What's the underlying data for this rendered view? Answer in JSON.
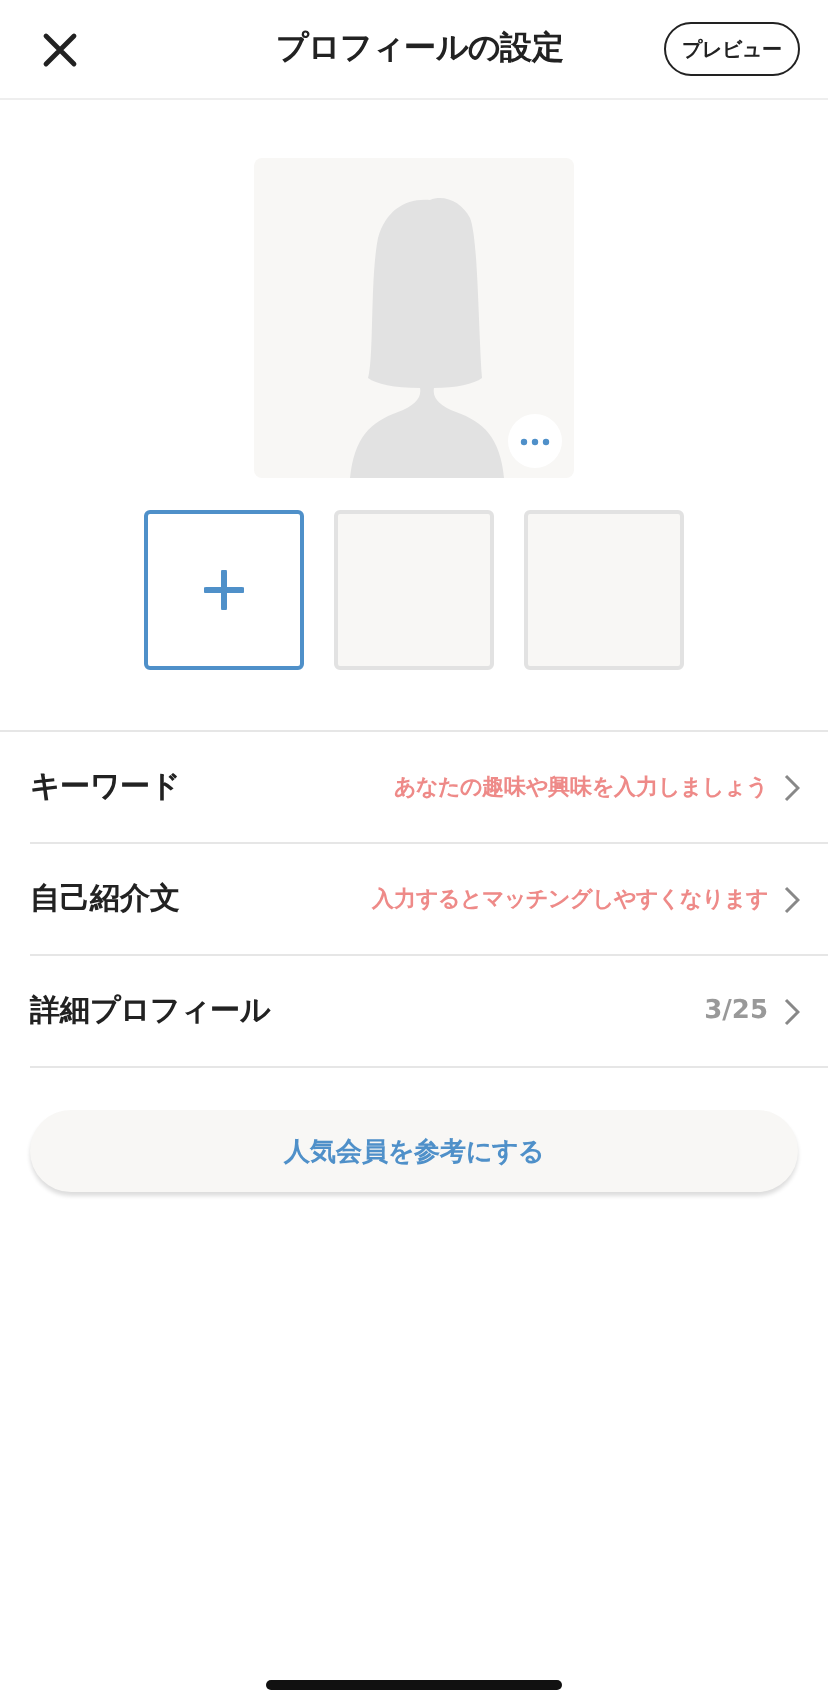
{
  "header": {
    "title": "プロフィールの設定",
    "preview_button": "プレビュー"
  },
  "photos": {
    "slots": [
      {
        "kind": "add"
      },
      {
        "kind": "empty"
      },
      {
        "kind": "empty"
      }
    ]
  },
  "rows": [
    {
      "label": "キーワード",
      "value": "あなたの趣味や興味を入力しましょう",
      "kind": "hint"
    },
    {
      "label": "自己紹介文",
      "value": "入力するとマッチングしやすくなります",
      "kind": "hint"
    },
    {
      "label": "詳細プロフィール",
      "value": "3/25",
      "kind": "count"
    }
  ],
  "reference_button": "人気会員を参考にする"
}
